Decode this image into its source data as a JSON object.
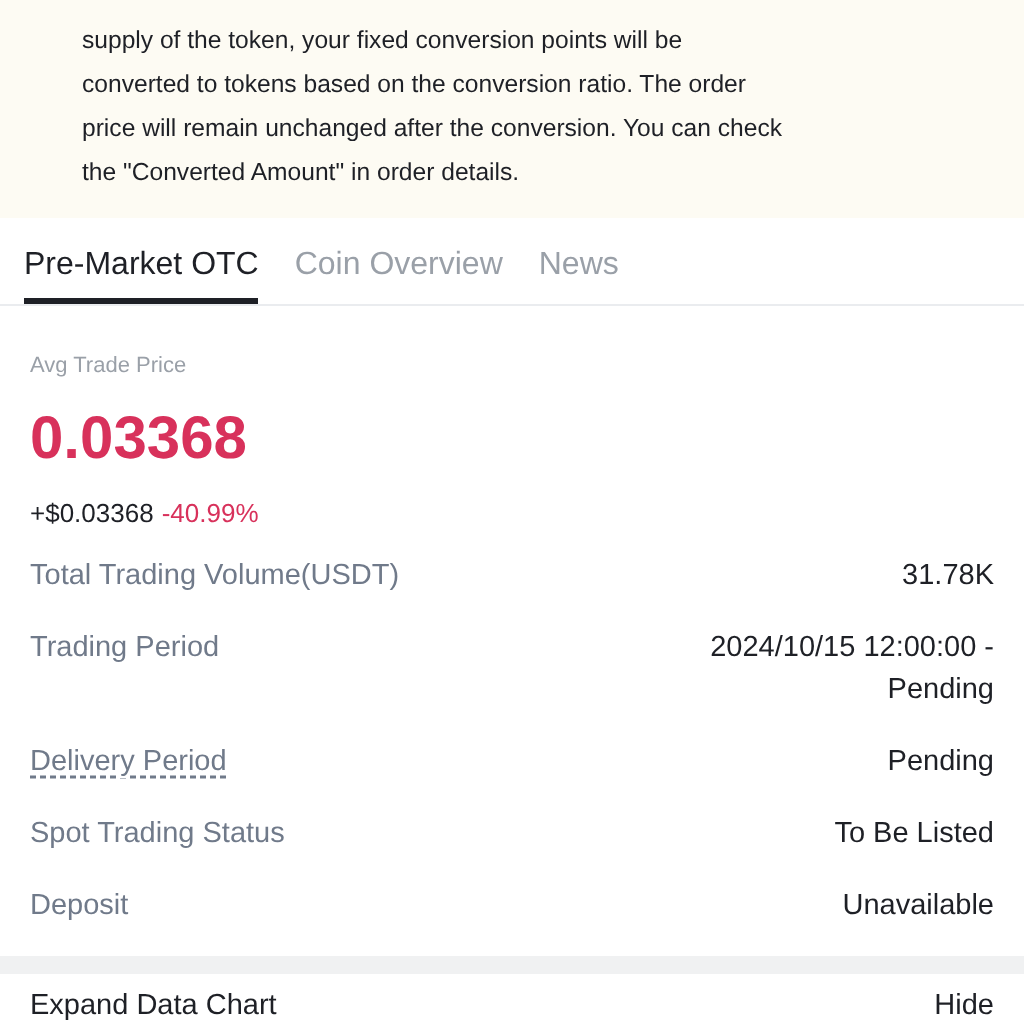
{
  "notice": {
    "text": "supply of the token, your fixed conversion points will be\nconverted to tokens based on the conversion ratio. The order\nprice will remain unchanged after the conversion. You can check\nthe \"Converted Amount\" in order details."
  },
  "tabs": [
    {
      "label": "Pre-Market OTC",
      "selected": true
    },
    {
      "label": "Coin Overview",
      "selected": false
    },
    {
      "label": "News",
      "selected": false
    }
  ],
  "price": {
    "label": "Avg Trade Price",
    "value": "0.03368",
    "change": "+$0.03368",
    "change_percent": "-40.99%"
  },
  "details": [
    {
      "label": "Total Trading Volume(USDT)",
      "value": "31.78K",
      "underlined": false
    },
    {
      "label": "Trading Period",
      "value": "2024/10/15 12:00:00 -\nPending",
      "underlined": false
    },
    {
      "label": "Delivery Period",
      "value": "Pending",
      "underlined": true
    },
    {
      "label": "Spot Trading Status",
      "value": "To Be Listed",
      "underlined": false
    },
    {
      "label": "Deposit",
      "value": "Unavailable",
      "underlined": false
    }
  ],
  "section": {
    "title": "Expand Data Chart",
    "action": "Hide"
  }
}
